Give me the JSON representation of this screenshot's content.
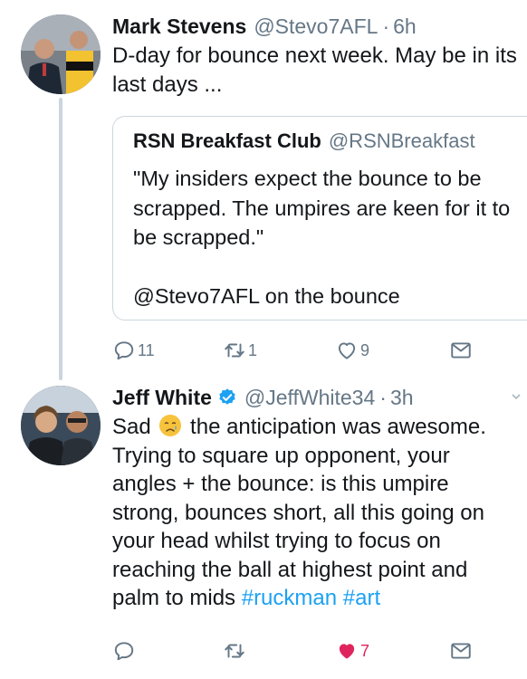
{
  "tweet1": {
    "name": "Mark Stevens",
    "handle": "@Stevo7AFL",
    "separator": "·",
    "time": "6h",
    "text": "D-day for bounce next week. May be in its last days ..."
  },
  "quote": {
    "name": "RSN Breakfast Club",
    "handle": "@RSNBreakfast",
    "paragraph1": "\"My insiders expect the bounce to be scrapped. The umpires are keen for it to be scrapped.\"",
    "paragraph2": "@Stevo7AFL on the bounce"
  },
  "tweet1_actions": {
    "reply_count": "11",
    "retweet_count": "1",
    "like_count": "9"
  },
  "tweet2": {
    "name": "Jeff White",
    "handle": "@JeffWhite34",
    "separator": "·",
    "time": "3h",
    "text_before_emoji": "Sad",
    "emoji": "crying-face",
    "text_after_emoji": "the anticipation was awesome. Trying to square up opponent, your angles + the bounce: is this umpire strong, bounces short, all this going on your head whilst trying to focus on reaching the ball at highest point and palm to mids",
    "hashtag1": "#ruckman",
    "hashtag2": "#art"
  },
  "tweet2_actions": {
    "like_count": "7"
  },
  "colors": {
    "link": "#1da1f2",
    "secondary_text": "#657786",
    "like_active": "#e0245e",
    "thread_line": "#cbd5de",
    "quote_border": "#ccd6dd"
  }
}
